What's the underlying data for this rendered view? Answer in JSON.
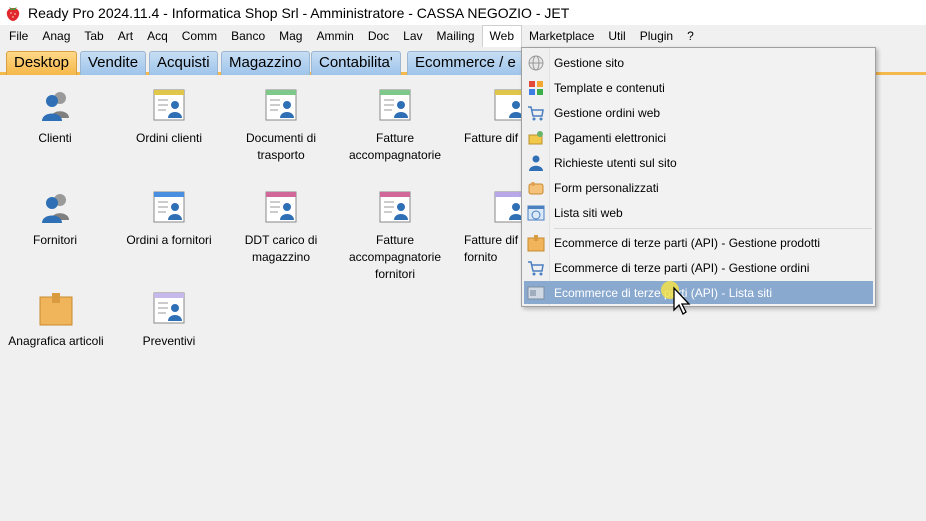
{
  "window": {
    "title": "Ready Pro 2024.11.4 - Informatica Shop Srl - Amministratore - CASSA NEGOZIO - JET"
  },
  "menu": [
    "File",
    "Anag",
    "Tab",
    "Art",
    "Acq",
    "Comm",
    "Banco",
    "Mag",
    "Ammin",
    "Doc",
    "Lav",
    "Mailing",
    "Web",
    "Marketplace",
    "Util",
    "Plugin",
    "?"
  ],
  "menu_active": "Web",
  "tabs": [
    "Desktop",
    "Vendite",
    "Acquisti",
    "Magazzino",
    "Contabilita'",
    "Ecommerce / e"
  ],
  "desktop_items": [
    "Clienti",
    "Ordini clienti",
    "Documenti di trasporto",
    "Fatture accompagnatorie",
    "Fatture dif",
    "Fornitori",
    "Ordini a fornitori",
    "DDT carico di magazzino",
    "Fatture accompagnatorie fornitori",
    "Fatture dif fornito",
    "Anagrafica articoli",
    "Preventivi"
  ],
  "web_menu": [
    "Gestione sito",
    "Template e contenuti",
    "Gestione ordini web",
    "Pagamenti elettronici",
    "Richieste utenti sul sito",
    "Form personalizzati",
    "Lista siti web",
    "Ecommerce di terze parti (API) - Gestione prodotti",
    "Ecommerce di terze parti (API) - Gestione ordini",
    "Ecommerce di terze parti (API) - Lista siti"
  ],
  "web_menu_highlighted": "Ecommerce di terze parti (API) - Lista siti",
  "colors": {
    "tab_active": "#f5b84a",
    "tab_inactive": "#9ec4ea",
    "menu_highlight": "#8aa9cf",
    "cursor_highlight": "#f2e24a"
  }
}
